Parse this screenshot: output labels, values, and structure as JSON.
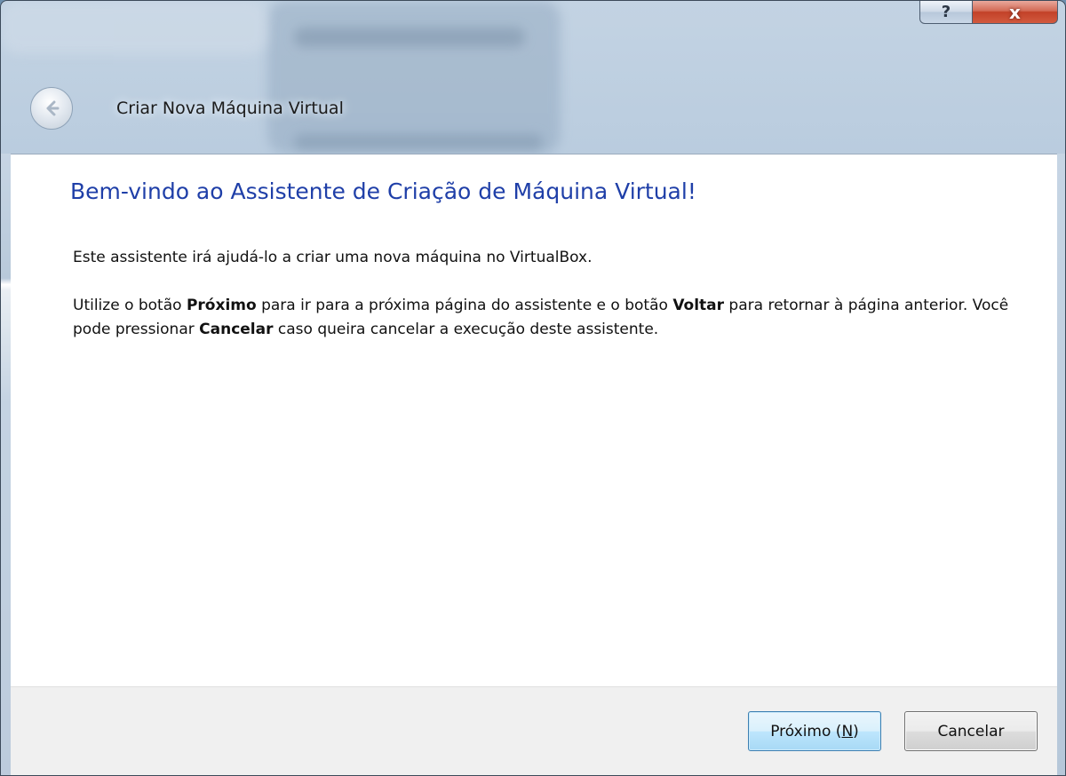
{
  "window": {
    "title": "Criar Nova Máquina Virtual",
    "help_label": "?",
    "close_label": "x"
  },
  "content": {
    "heading": "Bem-vindo ao Assistente de Criação de Máquina Virtual!",
    "intro": "Este assistente irá ajudá-lo a criar uma nova máquina no VirtualBox.",
    "instructions": {
      "part1": "Utilize o botão ",
      "next_word": "Próximo",
      "part2": " para ir para a próxima página do assistente e o botão ",
      "back_word": "Voltar",
      "part3": " para retornar à página anterior. Você pode pressionar ",
      "cancel_word": "Cancelar",
      "part4": " caso queira cancelar a execução deste assistente."
    }
  },
  "footer": {
    "next_button": {
      "label_prefix": "Próximo (",
      "mnemonic": "N",
      "label_suffix": ")"
    },
    "cancel_button": {
      "label": "Cancelar"
    }
  },
  "colors": {
    "heading": "#1f3fa8",
    "default_button_border": "#3c7fb1",
    "close_button": "#c24128"
  }
}
